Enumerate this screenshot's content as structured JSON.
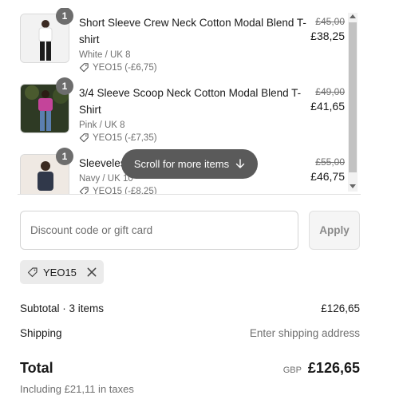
{
  "cart": {
    "items": [
      {
        "quantity": "1",
        "title": "Short Sleeve Crew Neck Cotton Modal Blend T-shirt",
        "variant": "White / UK 8",
        "discount": "YEO15 (-£6,75)",
        "original_price": "£45,00",
        "final_price": "£38,25"
      },
      {
        "quantity": "1",
        "title": "3/4 Sleeve Scoop Neck Cotton Modal Blend T-Shirt",
        "variant": "Pink / UK 8",
        "discount": "YEO15 (-£7,35)",
        "original_price": "£49,00",
        "final_price": "£41,65"
      },
      {
        "quantity": "1",
        "title": "Sleeveles",
        "variant": "Navy / UK 10",
        "discount": "YEO15 (-£8,25)",
        "original_price": "£55,00",
        "final_price": "£46,75"
      }
    ],
    "scroll_hint": "Scroll for more items"
  },
  "discount": {
    "placeholder": "Discount code or gift card",
    "apply_label": "Apply",
    "applied_code": "YEO15"
  },
  "summary": {
    "subtotal_label": "Subtotal · 3 items",
    "subtotal_value": "£126,65",
    "shipping_label": "Shipping",
    "shipping_value": "Enter shipping address",
    "total_label": "Total",
    "currency": "GBP",
    "total_value": "£126,65",
    "taxes_note": "Including £21,11 in taxes"
  },
  "icons": {
    "tag": "tag-icon",
    "arrow": "arrow-down-icon",
    "close": "close-icon"
  },
  "colors": {
    "badge": "#6d6d6d",
    "scroll_pill": "#5a5a5a",
    "chip_bg": "#ebebeb"
  }
}
